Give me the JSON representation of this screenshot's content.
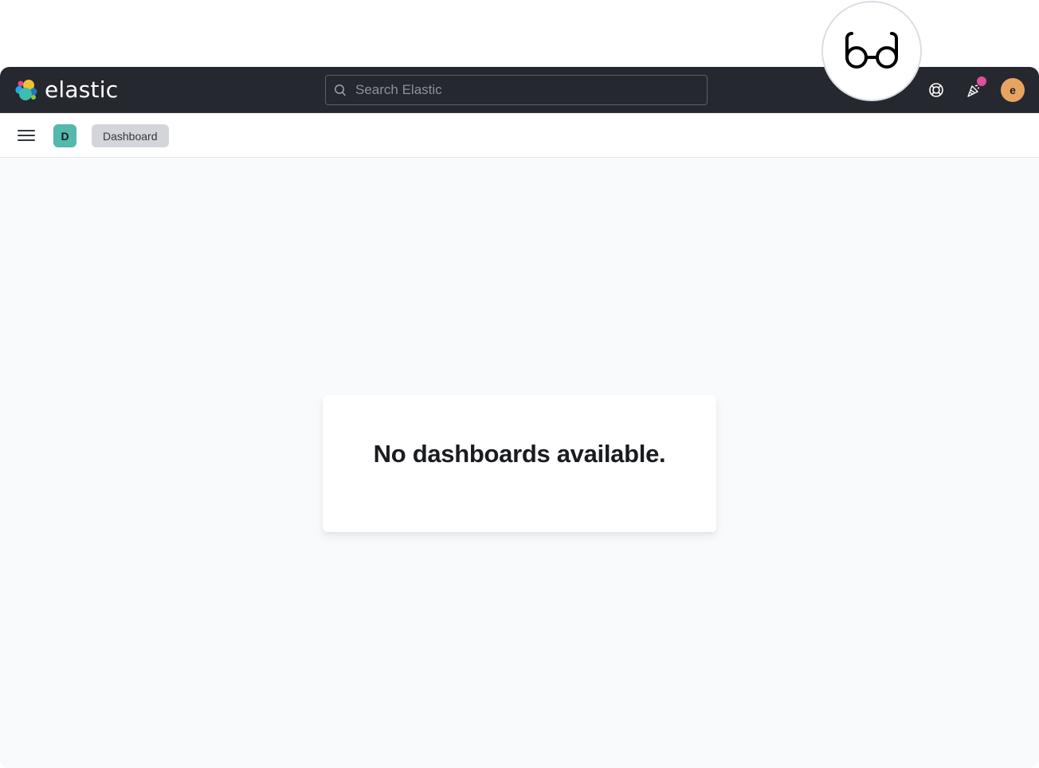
{
  "app": {
    "brand": "elastic",
    "colors": {
      "header_bg": "#25282f",
      "space_badge": "#54b8ad",
      "avatar": "#e7a461",
      "notification_dot": "#e0509a"
    }
  },
  "header": {
    "search_placeholder": "Search Elastic",
    "search_value": "",
    "icons": [
      "help-icon",
      "newsfeed-icon"
    ],
    "user_initial": "e"
  },
  "subheader": {
    "space_initial": "D",
    "breadcrumbs": [
      {
        "label": "Dashboard"
      }
    ]
  },
  "main": {
    "empty_message": "No dashboards available."
  },
  "overlay": {
    "icon": "glasses-icon"
  }
}
